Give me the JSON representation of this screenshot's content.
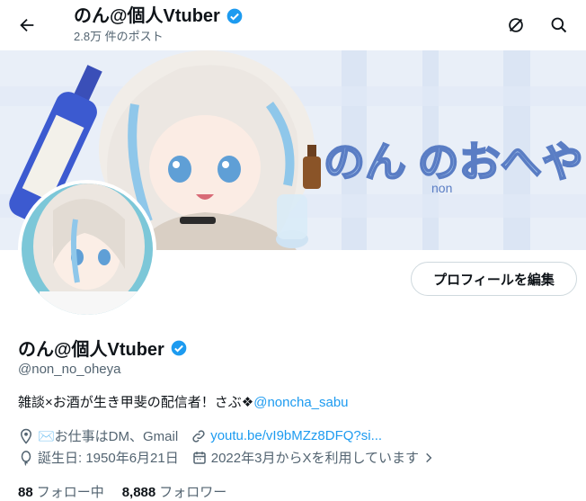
{
  "header": {
    "name": "のん@個人Vtuber",
    "post_count": "2.8万 件のポスト"
  },
  "banner": {
    "logo_text": "のん のおへや",
    "logo_sub": "non"
  },
  "profile": {
    "edit_button": "プロフィールを編集",
    "name": "のん@個人Vtuber",
    "handle": "@non_no_oheya",
    "bio_text": "雑談×お酒が生き甲斐の配信者！さぶ❖",
    "bio_link": "@noncha_sabu",
    "work": "✉️お仕事はDM、Gmail",
    "website": "youtu.be/vI9bMZz8DFQ?si...",
    "birthday": "誕生日: 1950年6月21日",
    "joined": "2022年3月からXを利用しています",
    "following_count": "88",
    "following_label": "フォロー中",
    "followers_count": "8,888",
    "followers_label": "フォロワー"
  },
  "colors": {
    "accent": "#1d9bf0",
    "secondary_text": "#536471",
    "verified": "#1d9bf0"
  }
}
